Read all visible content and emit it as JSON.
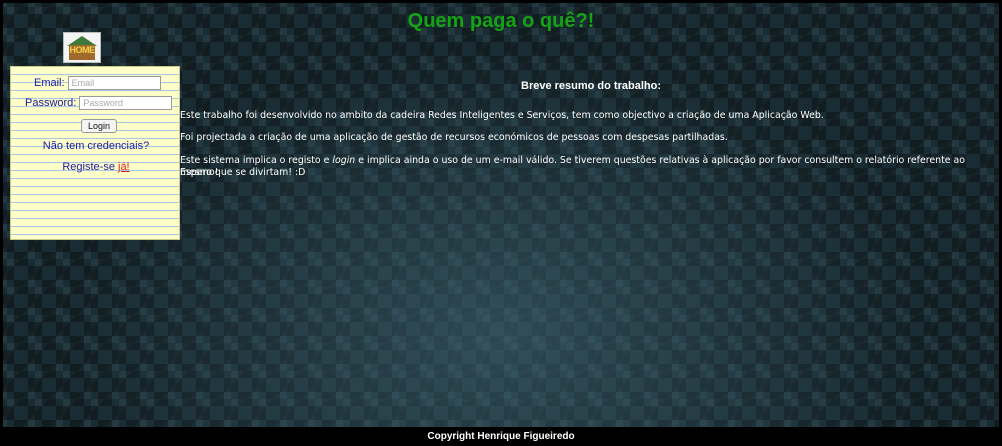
{
  "header": {
    "title": "Quem paga o quê?!",
    "logo_text": "HOME"
  },
  "login": {
    "email_label": "Email:",
    "email_placeholder": "Email",
    "password_label": "Password:",
    "password_placeholder": "Password",
    "login_button": "Login",
    "no_credentials": "Não tem credenciais?",
    "register_text": "Registe-se ",
    "register_link": "já!"
  },
  "summary": {
    "title": "Breve resumo do trabalho:",
    "p1": "Este trabalho foi desenvolvido no ambito da cadeira Redes Inteligentes e Serviços, tem como objectivo a criação de uma Aplicação Web.",
    "p2": "Foi projectada a criação de uma aplicação de gestão de recursos económicos de pessoas com despesas partilhadas.",
    "p3_a": "Este sistema implica o registo e ",
    "p3_login": "login",
    "p3_b": " e implica ainda o uso de um e-mail válido. Se tiverem questões relativas à aplicação por favor consultem o relatório referente ao mesmo!",
    "p4": "Espero que se divirtam! :D"
  },
  "footer": {
    "copyright": "Copyright Henrique Figueiredo"
  },
  "colors": {
    "title_green": "#13a313",
    "link_blue": "#1a1aa8",
    "register_red": "#e02020",
    "panel_yellow": "#fefec8"
  }
}
